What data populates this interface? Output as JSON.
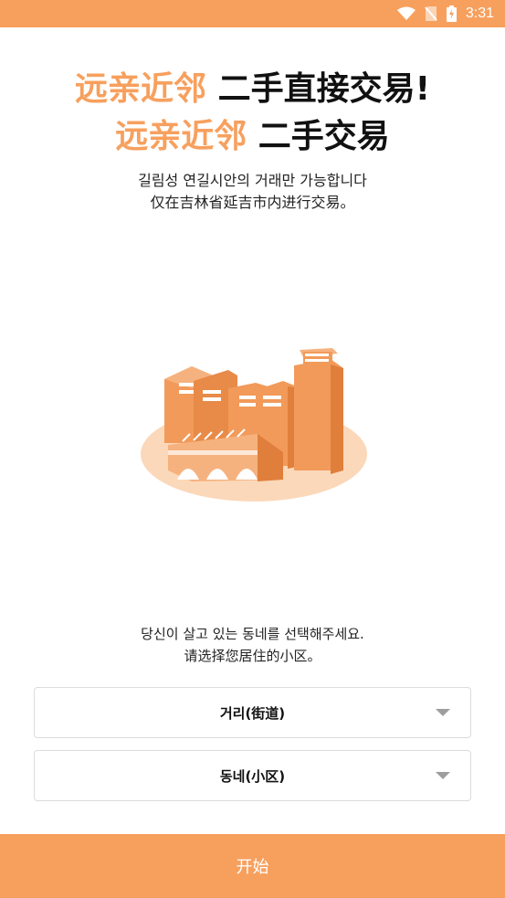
{
  "status_bar": {
    "time": "3:31",
    "icons": [
      "wifi-icon",
      "no-sim-icon",
      "battery-charging-icon"
    ]
  },
  "headline": {
    "line1_accent": "远亲近邻",
    "line1_rest": " 二手直接交易!",
    "line2_accent": "远亲近邻",
    "line2_rest": " 二手交易"
  },
  "subtitle": {
    "korean": "길림성 연길시안의 거래만 가능합니다",
    "chinese": "仅在吉林省延吉市内进行交易。"
  },
  "illustration": {
    "icon": "city-buildings-illustration"
  },
  "prompt": {
    "korean": "당신이 살고 있는 동네를 선택해주세요.",
    "chinese": "请选择您居住的小区。"
  },
  "street_select": {
    "label": "거리(街道)"
  },
  "community_select": {
    "label": "동네(小区)"
  },
  "start_button": {
    "label": "开始"
  },
  "colors": {
    "accent": "#F7A05E",
    "building_front": "#F29A5A",
    "building_side": "#E07F3B",
    "ground": "#FBD8BA"
  }
}
